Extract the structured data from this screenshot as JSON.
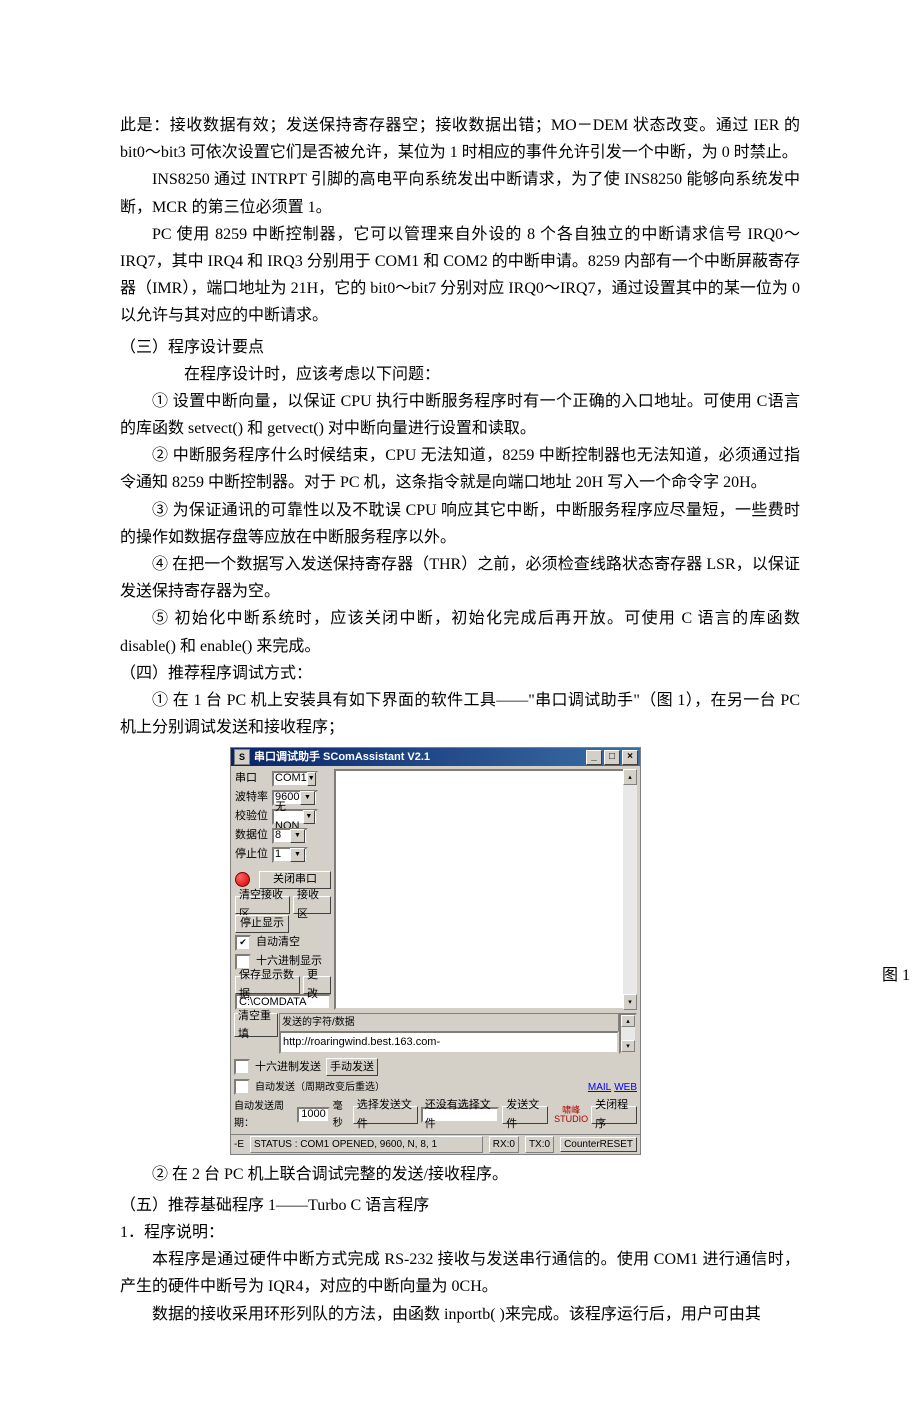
{
  "doc": {
    "p1": "此是：接收数据有效；发送保持寄存器空；接收数据出错；MO－DEM 状态改变。通过 IER 的 bit0～bit3 可依次设置它们是否被允许，某位为 1 时相应的事件允许引发一个中断，为 0 时禁止。",
    "p2": "INS8250 通过 INTRPT 引脚的高电平向系统发出中断请求，为了使 INS8250 能够向系统发中断，MCR 的第三位必须置 1。",
    "p3": "PC 使用 8259 中断控制器，它可以管理来自外设的 8 个各自独立的中断请求信号 IRQ0～IRQ7，其中 IRQ4 和 IRQ3 分别用于 COM1 和 COM2 的中断申请。8259 内部有一个中断屏蔽寄存器（IMR），端口地址为 21H，它的 bit0～bit7 分别对应 IRQ0～IRQ7，通过设置其中的某一位为 0 以允许与其对应的中断请求。",
    "h3": "（三）程序设计要点",
    "p4": "在程序设计时，应该考虑以下问题：",
    "p5": "① 设置中断向量，以保证 CPU 执行中断服务程序时有一个正确的入口地址。可使用 C语言的库函数 setvect()  和 getvect()  对中断向量进行设置和读取。",
    "p6": "② 中断服务程序什么时候结束，CPU 无法知道，8259 中断控制器也无法知道，必须通过指令通知 8259 中断控制器。对于 PC 机，这条指令就是向端口地址 20H 写入一个命令字 20H。",
    "p7": "③ 为保证通讯的可靠性以及不耽误 CPU 响应其它中断，中断服务程序应尽量短，一些费时的操作如数据存盘等应放在中断服务程序以外。",
    "p8": "④ 在把一个数据写入发送保持寄存器（THR）之前，必须检查线路状态寄存器 LSR，以保证发送保持寄存器为空。",
    "p9": "⑤ 初始化中断系统时，应该关闭中断，初始化完成后再开放。可使用 C 语言的库函数disable()  和 enable()  来完成。",
    "h4": "（四）推荐程序调试方式：",
    "p10": "① 在 1 台 PC 机上安装具有如下界面的软件工具——\"串口调试助手\"（图 1），在另一台 PC 机上分别调试发送和接收程序；",
    "fig_label": "图 1",
    "p11": "② 在 2 台 PC 机上联合调试完整的发送/接收程序。",
    "h5": "（五）推荐基础程序 1——Turbo C  语言程序",
    "p12": "1．程序说明：",
    "p13": "本程序是通过硬件中断方式完成 RS-232 接收与发送串行通信的。使用 COM1 进行通信时，产生的硬件中断号为 IQR4，对应的中断向量为 0CH。",
    "p14": "数据的接收采用环形列队的方法，由函数 inportb( )来完成。该程序运行后，用户可由其"
  },
  "app": {
    "title": "串口调试助手 SComAssistant V2.1",
    "min": "_",
    "max": "□",
    "close": "×",
    "side": {
      "port_lbl": "串口",
      "port_val": "COM1",
      "baud_lbl": "波特率",
      "baud_val": "9600",
      "parity_lbl": "校验位",
      "parity_val": "无NON",
      "data_lbl": "数据位",
      "data_val": "8",
      "stop_lbl": "停止位",
      "stop_val": "1",
      "close_port": "关闭串口",
      "clear_recv": "清空接收区",
      "recv_area": "接收区",
      "stop_disp": "停止显示",
      "auto_clear": "自动清空",
      "hex_disp": "十六进制显示",
      "save_disp": "保存显示数据",
      "change": "更改",
      "path": "C:\\COMDATA"
    },
    "send": {
      "clear_fill": "清空重填",
      "send_hint_lbl": "发送的字符/数据",
      "send_box": "http://roaringwind.best.163.com-",
      "hex_send": "十六进制发送",
      "manual_send": "手动发送",
      "auto_send": "自动发送（周期改变后重选）",
      "auto_period_lbl": "自动发送周期：",
      "auto_period_val": "1000",
      "ms": "毫秒",
      "choose_file": "选择发送文件",
      "no_file": "还没有选择文件",
      "send_file": "发送文件",
      "mail": "MAIL",
      "web": "WEB",
      "studio1": "啸峰",
      "studio2": "STUDIO",
      "close_prog": "关闭程序"
    },
    "status": {
      "icon": "-E",
      "text": "STATUS : COM1 OPENED, 9600, N, 8, 1",
      "rx": "RX:0",
      "tx": "TX:0",
      "reset": "CounterRESET"
    }
  }
}
